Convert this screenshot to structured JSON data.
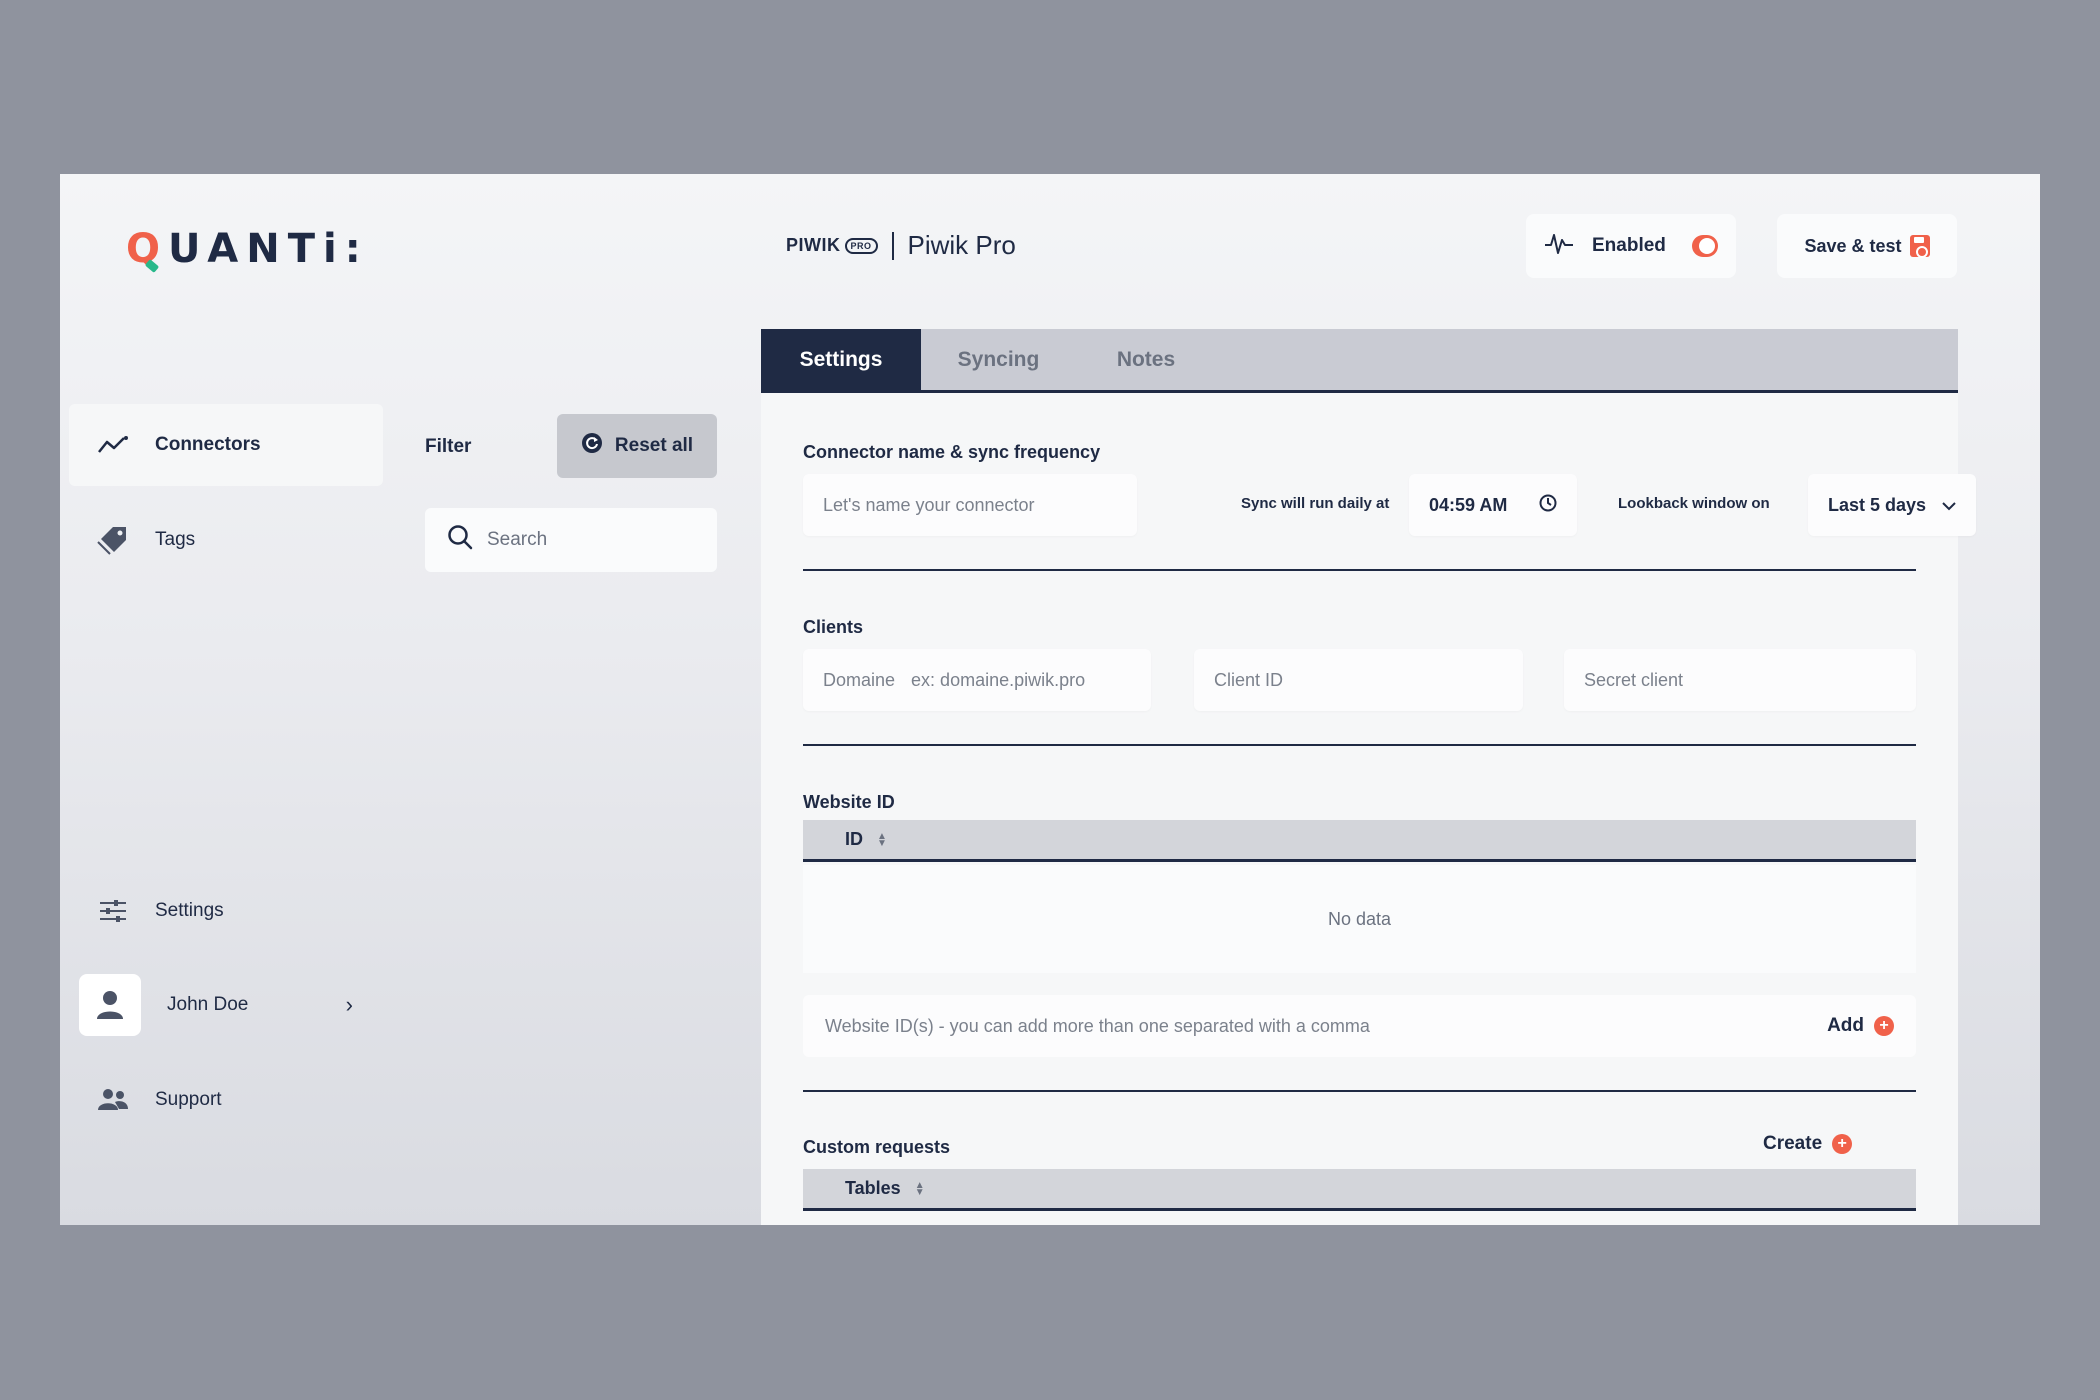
{
  "brand": {
    "logo_q": "Q",
    "logo_rest": "UANTi",
    "logo_tail": ":"
  },
  "connector": {
    "brand_name": "PIWIK",
    "brand_badge": "PRO",
    "name": "Piwik Pro"
  },
  "header": {
    "status_label": "Enabled",
    "enabled": true,
    "save_label": "Save & test"
  },
  "sidebar": {
    "top_items": [
      {
        "label": "Connectors",
        "icon": "trend-line-icon",
        "active": true
      },
      {
        "label": "Tags",
        "icon": "tag-icon",
        "active": false
      }
    ],
    "bottom_items": [
      {
        "label": "Settings",
        "icon": "sliders-icon"
      },
      {
        "label": "John Doe",
        "icon": "user-icon"
      },
      {
        "label": "Support",
        "icon": "users-icon"
      }
    ]
  },
  "filter": {
    "label": "Filter",
    "reset_label": "Reset all",
    "search_placeholder": "Search"
  },
  "tabs": [
    {
      "label": "Settings",
      "active": true
    },
    {
      "label": "Syncing",
      "active": false
    },
    {
      "label": "Notes",
      "active": false
    }
  ],
  "settings": {
    "section_name": "Connector name & sync frequency",
    "name_placeholder": "Let's name your connector",
    "sync_label": "Sync will run daily at",
    "sync_time": "04:59 AM",
    "lookback_label": "Lookback window on",
    "lookback_value": "Last 5 days",
    "clients_title": "Clients",
    "domain_label": "Domaine",
    "domain_placeholder": "ex: domaine.piwik.pro",
    "client_id_placeholder": "Client ID",
    "secret_placeholder": "Secret client",
    "website_title": "Website ID",
    "id_column": "ID",
    "no_data": "No data",
    "website_input_placeholder": "Website ID(s) - you can add more than one separated with a comma",
    "add_label": "Add",
    "custom_title": "Custom requests",
    "create_label": "Create",
    "tables_column": "Tables"
  },
  "colors": {
    "accent": "#f0614a",
    "navy": "#1f2a44",
    "green": "#28b88a"
  }
}
